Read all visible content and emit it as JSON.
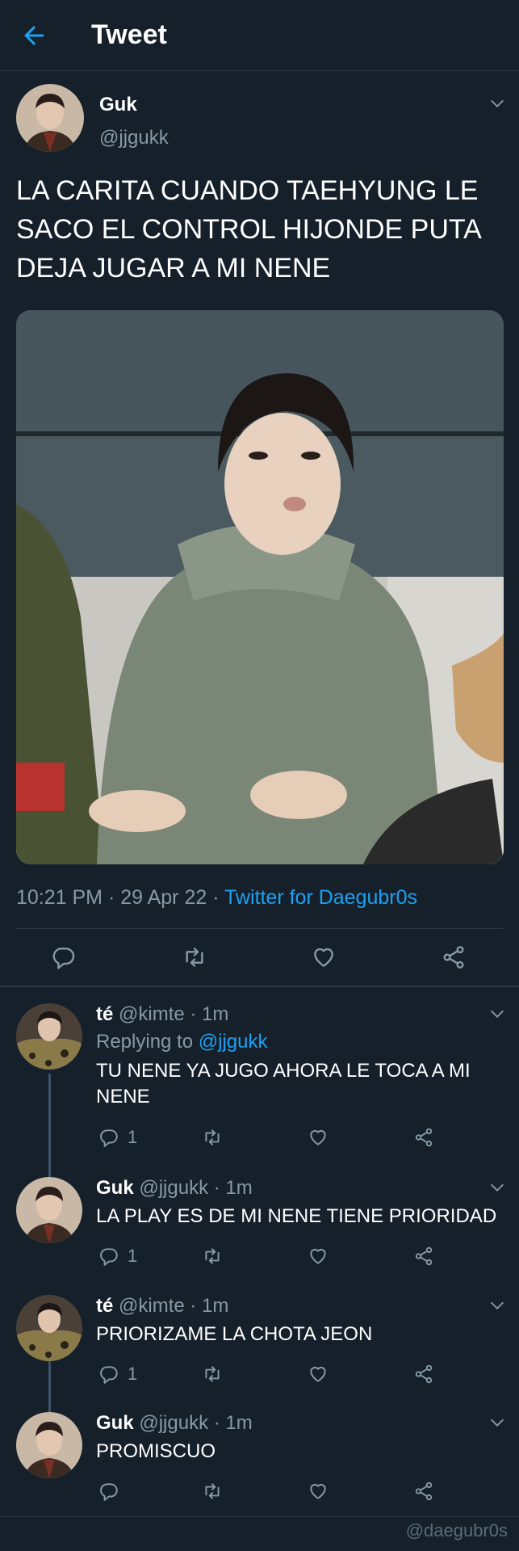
{
  "header": {
    "title": "Tweet",
    "back_icon": "arrow-left-icon",
    "accent": "#1da1f2"
  },
  "tweet": {
    "author_name": "Guk",
    "author_handle": "@jjgukk",
    "text": "LA CARITA CUANDO TAEHYUNG LE SACO EL CONTROL HIJONDE PUTA DEJA JUGAR A MI NENE",
    "time": "10:21 PM",
    "date": "29 Apr 22",
    "source": "Twitter for Daegubr0s",
    "sep": " · ",
    "actions": [
      "reply-icon",
      "retweet-icon",
      "like-icon",
      "share-icon"
    ]
  },
  "replies": [
    {
      "name": "té",
      "handle": "@kimte",
      "time": "1m",
      "replying_label": "Replying to",
      "replying_to": "@jjgukk",
      "text": "TU NENE YA JUGO AHORA LE TOCA A MI NENE",
      "reply_count": "1"
    },
    {
      "name": "Guk",
      "handle": "@jjgukk",
      "time": "1m",
      "text": "LA PLAY ES DE MI NENE TIENE PRIORIDAD",
      "reply_count": "1"
    },
    {
      "name": "té",
      "handle": "@kimte",
      "time": "1m",
      "text": "PRIORIZAME LA CHOTA JEON",
      "reply_count": "1"
    },
    {
      "name": "Guk",
      "handle": "@jjgukk",
      "time": "1m",
      "text": "PROMISCUO",
      "reply_count": ""
    }
  ],
  "watermark": "@daegubr0s",
  "colors": {
    "background": "#15202b",
    "secondary_text": "#8899a6",
    "link": "#1da1f2",
    "divider": "#2c3946"
  }
}
